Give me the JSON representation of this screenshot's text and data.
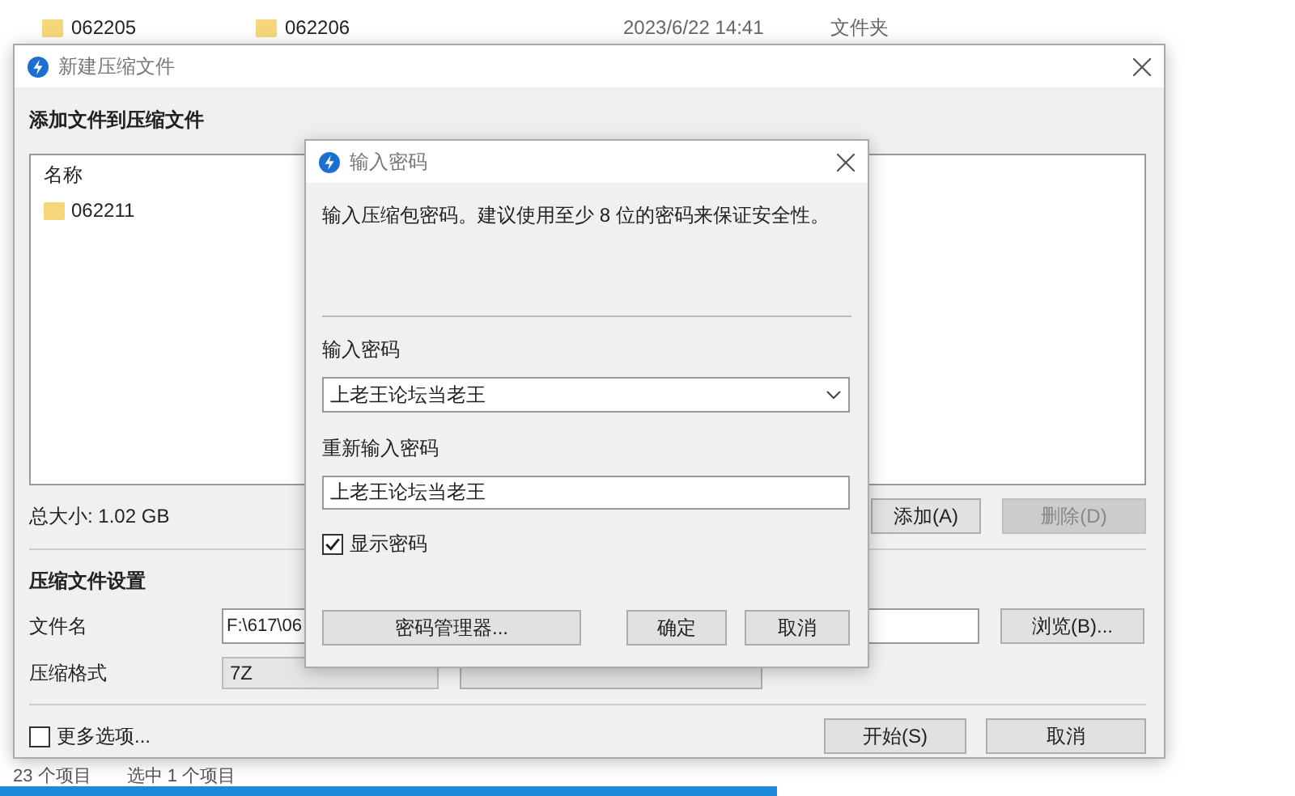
{
  "explorer": {
    "rows": [
      {
        "name_1": "062205",
        "name_2": "062206",
        "date": "2023/6/22 14:41",
        "type": "文件夹"
      }
    ],
    "status_bar": [
      "23 个项目",
      "选中 1 个项目"
    ]
  },
  "main_dialog": {
    "title": "新建压缩文件",
    "section_title": "添加文件到压缩文件",
    "list": {
      "column": "名称",
      "items": [
        {
          "name": "062211"
        }
      ]
    },
    "total_size": "总大小: 1.02 GB",
    "list_buttons": [
      {
        "label": "添加(A)",
        "disabled": false
      },
      {
        "label": "删除(D)",
        "disabled": true
      }
    ],
    "settings_title": "压缩文件设置",
    "filename_label": "文件名",
    "filename_value": "F:\\617\\06",
    "browse_button": "浏览(B)...",
    "format_label": "压缩格式",
    "format_value": "7Z",
    "more_options": {
      "label": "更多选项...",
      "checked": false
    },
    "footer_buttons": [
      {
        "label": "开始(S)"
      },
      {
        "label": "取消"
      }
    ]
  },
  "password_dialog": {
    "title": "输入密码",
    "description": "输入压缩包密码。建议使用至少 8 位的密码来保证安全性。",
    "password_label": "输入密码",
    "password_value": "上老王论坛当老王",
    "confirm_label": "重新输入密码",
    "confirm_value": "上老王论坛当老王",
    "show_password": {
      "label": "显示密码",
      "checked": true
    },
    "buttons": [
      {
        "label": "密码管理器..."
      },
      {
        "label": "确定"
      },
      {
        "label": "取消"
      }
    ]
  }
}
